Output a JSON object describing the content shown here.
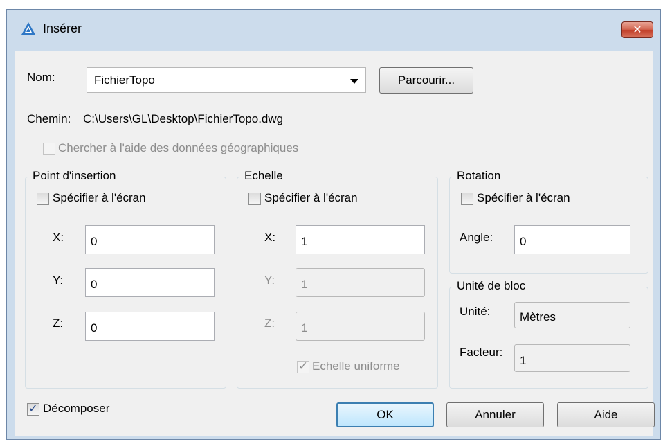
{
  "window": {
    "title": "Insérer",
    "close_glyph": "✕"
  },
  "name": {
    "label": "Nom:",
    "value": "FichierTopo",
    "browse_label": "Parcourir..."
  },
  "path": {
    "label": "Chemin:",
    "value": "C:\\Users\\GL\\Desktop\\FichierTopo.dwg"
  },
  "geo": {
    "label": "Chercher à l'aide des données géographiques",
    "checked": false,
    "enabled": false
  },
  "insertion_point": {
    "title": "Point d'insertion",
    "specify_label": "Spécifier à l'écran",
    "x_label": "X:",
    "x_value": "0",
    "y_label": "Y:",
    "y_value": "0",
    "z_label": "Z:",
    "z_value": "0"
  },
  "scale": {
    "title": "Echelle",
    "specify_label": "Spécifier à l'écran",
    "x_label": "X:",
    "x_value": "1",
    "y_label": "Y:",
    "y_value": "1",
    "z_label": "Z:",
    "z_value": "1",
    "uniform_label": "Echelle uniforme"
  },
  "rotation": {
    "title": "Rotation",
    "specify_label": "Spécifier à l'écran",
    "angle_label": "Angle:",
    "angle_value": "0"
  },
  "block_unit": {
    "title": "Unité de bloc",
    "unit_label": "Unité:",
    "unit_value": "Mètres",
    "factor_label": "Facteur:",
    "factor_value": "1"
  },
  "explode": {
    "label": "Décomposer",
    "checked": true
  },
  "buttons": {
    "ok": "OK",
    "cancel": "Annuler",
    "help": "Aide"
  },
  "checkmark_glyph": "✓",
  "colors": {
    "frame": "#ccdcec",
    "client": "#f0f0f0",
    "close": "#c2412b",
    "accent": "#3c7fb1"
  }
}
